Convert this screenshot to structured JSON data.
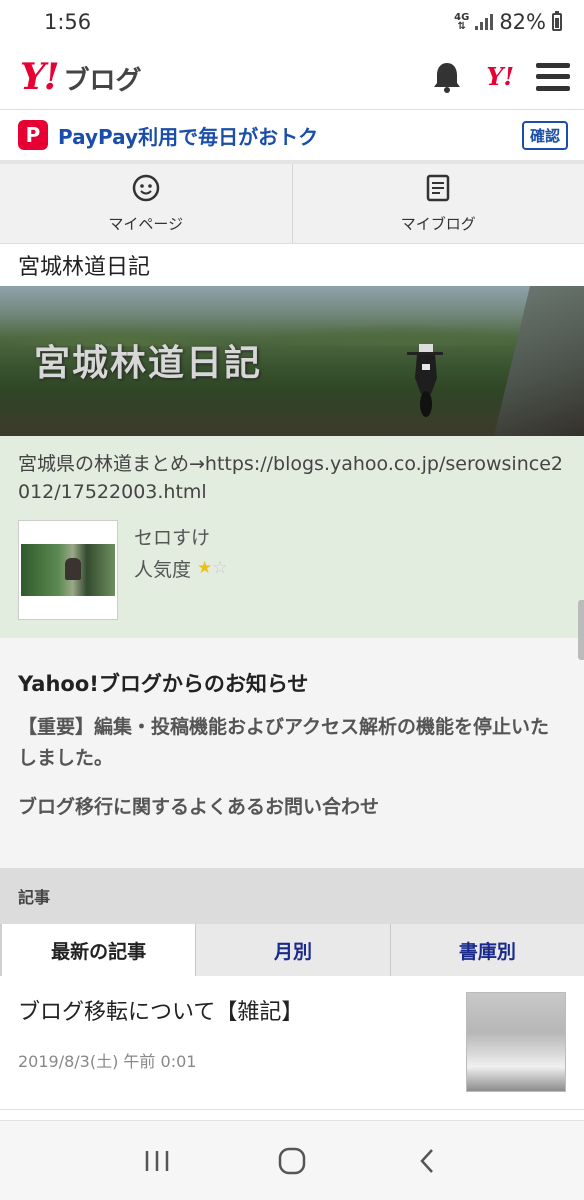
{
  "status_bar": {
    "time": "1:56",
    "network": "4G",
    "battery": "82%"
  },
  "header": {
    "logo_y": "Y!",
    "logo_text": "ブログ",
    "yahoo_mark": "Y!"
  },
  "promo": {
    "text": "PayPay利用で毎日がおトク",
    "button": "確認",
    "brand_color": "#e60033"
  },
  "quick_nav": [
    {
      "label": "マイページ",
      "icon": "smiley-icon"
    },
    {
      "label": "マイブログ",
      "icon": "document-icon"
    }
  ],
  "blog": {
    "title": "宮城林道日記",
    "banner_title": "宮城林道日記",
    "description": "宮城県の林道まとめ→https://blogs.yahoo.co.jp/serowsince2012/17522003.html",
    "author": "セロすけ",
    "popularity_label": "人気度",
    "popularity_stars": 1,
    "popularity_max": 2
  },
  "notice": {
    "title": "Yahoo!ブログからのお知らせ",
    "body": "【重要】編集・投稿機能およびアクセス解析の機能を停止いたしました。",
    "link": "ブログ移行に関するよくあるお問い合わせ"
  },
  "articles_section": {
    "heading": "記事",
    "tabs": [
      "最新の記事",
      "月別",
      "書庫別"
    ],
    "active_tab": 0,
    "items": [
      {
        "title": "ブログ移転について【雑記】",
        "date": "2019/8/3(土) 午前 0:01"
      }
    ]
  },
  "colors": {
    "accent": "#e60033",
    "link_blue": "#1a4ea8",
    "profile_bg": "#e2ede0"
  }
}
